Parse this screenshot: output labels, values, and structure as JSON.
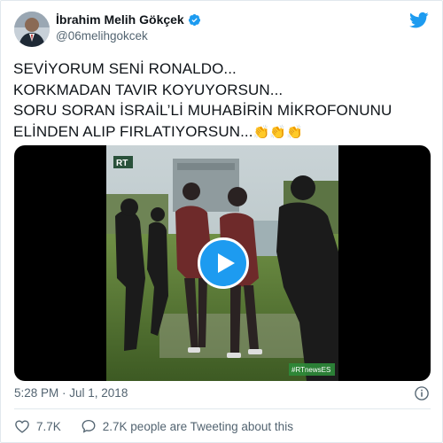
{
  "tweet": {
    "author_name": "İbrahim Melih Gökçek",
    "author_handle": "@06melihgokcek",
    "verified_icon": "verified-badge-icon",
    "avatar_icon": "avatar",
    "platform_icon": "twitter-bird-icon",
    "text_lines": [
      "SEVİYORUM SENİ RONALDO...",
      "KORKMADAN TAVIR KOYUYORSUN...",
      "SORU SORAN İSRAİL’Lİ MUHABİRİN MİKROFONUNU",
      "ELİNDEN ALIP FIRLATIYORSUN..."
    ],
    "text_trailing_emoji": "👏👏👏",
    "media": {
      "watermark_top": "RT",
      "watermark_bottom": "#RTnewsES",
      "play_icon": "play-icon"
    },
    "timestamp": "5:28 PM · Jul 1, 2018",
    "info_icon": "info-icon",
    "likes": "7.7K",
    "retweet_text": "2.7K people are Tweeting about this",
    "colors": {
      "accent": "#1d9bf0",
      "text": "#0f1419",
      "muted": "#536471",
      "border": "#e1e8ed"
    }
  }
}
